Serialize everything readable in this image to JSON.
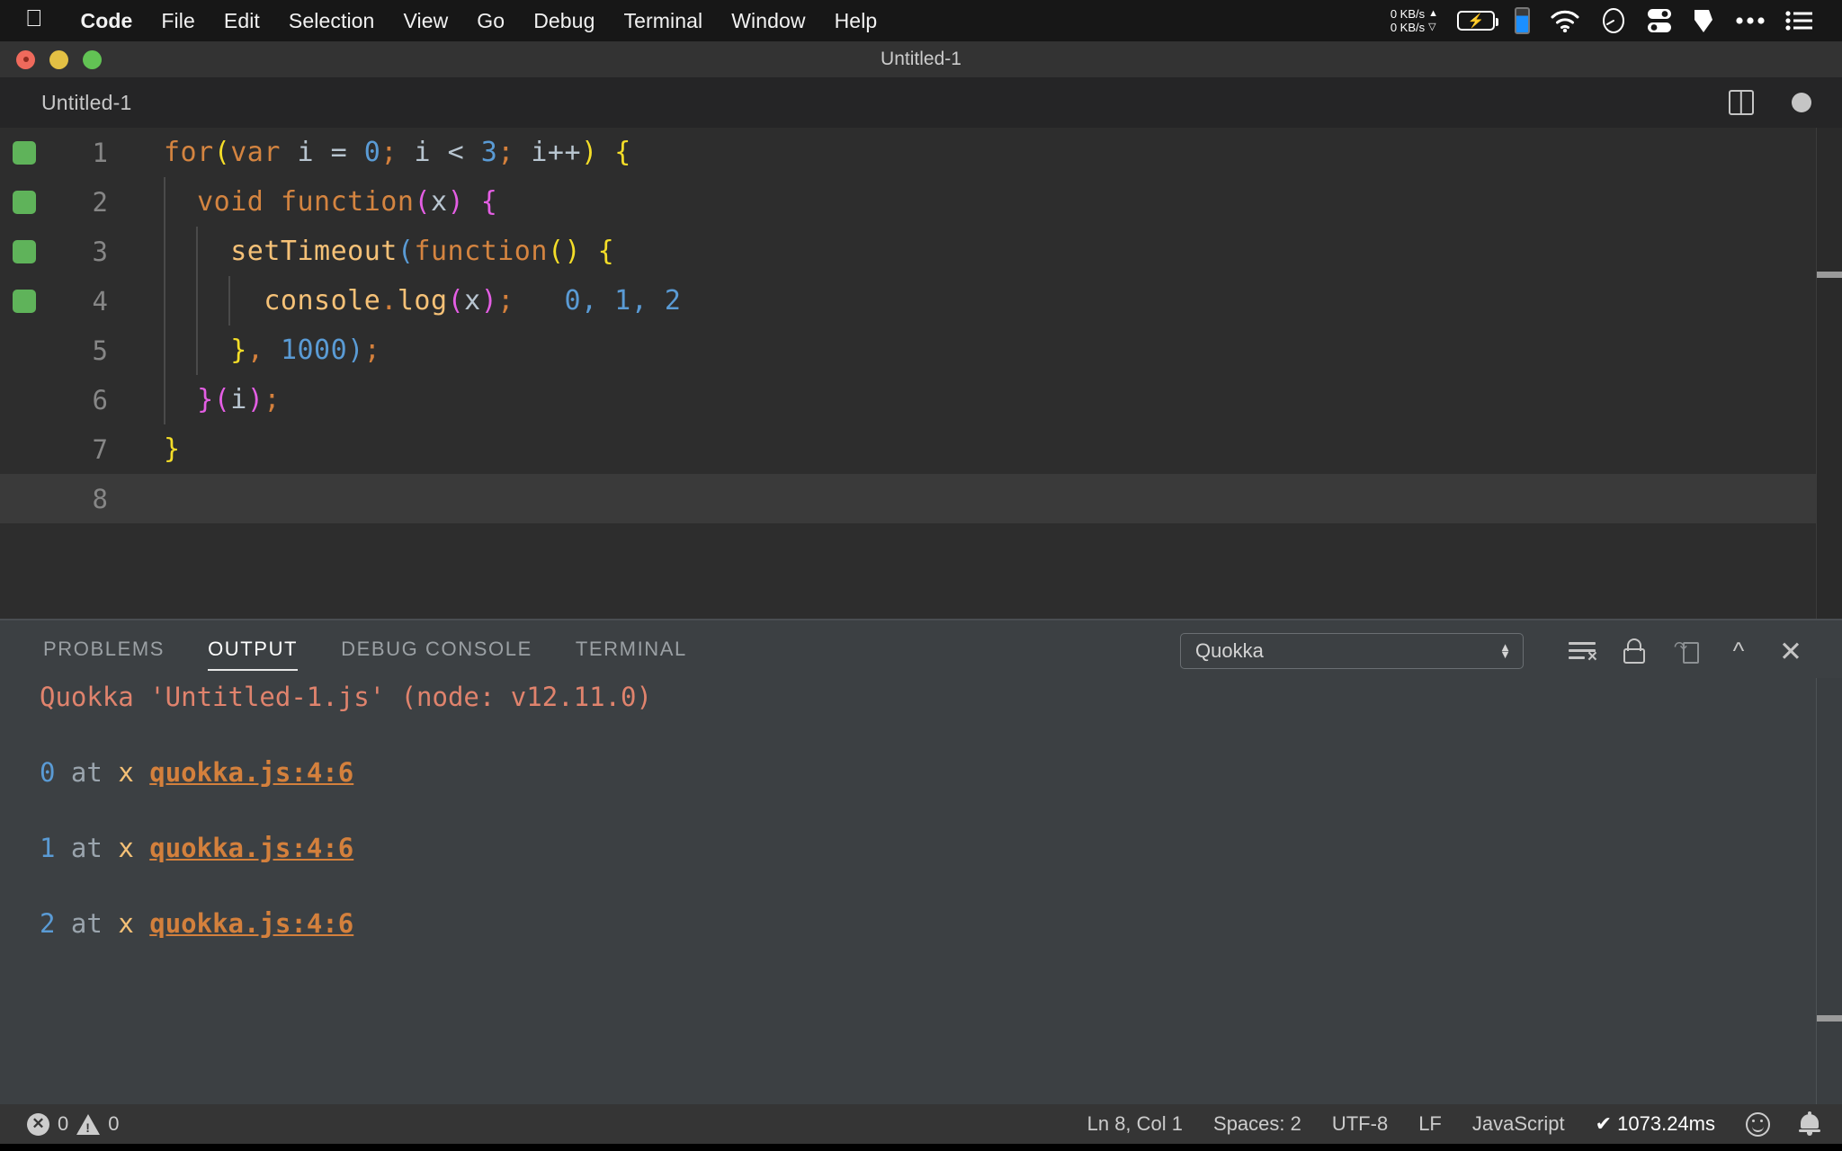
{
  "menubar": {
    "apple_icon": "apple-logo-icon",
    "items": [
      {
        "label": "Code",
        "bold": true
      },
      {
        "label": "File",
        "bold": false
      },
      {
        "label": "Edit",
        "bold": false
      },
      {
        "label": "Selection",
        "bold": false
      },
      {
        "label": "View",
        "bold": false
      },
      {
        "label": "Go",
        "bold": false
      },
      {
        "label": "Debug",
        "bold": false
      },
      {
        "label": "Terminal",
        "bold": false
      },
      {
        "label": "Window",
        "bold": false
      },
      {
        "label": "Help",
        "bold": false
      }
    ],
    "network": {
      "upload": "0 KB/s",
      "download": "0 KB/s",
      "up_arrow": "▲",
      "down_arrow": "▽"
    },
    "status_icons": [
      "battery-charging-icon",
      "blue-level-indicator-icon",
      "wifi-icon",
      "gauge-icon",
      "toggles-icon",
      "shield-pen-icon",
      "ellipsis-icon",
      "list-menu-icon"
    ]
  },
  "window": {
    "title": "Untitled-1",
    "traffic_lights": [
      "close-button",
      "minimize-button",
      "zoom-button"
    ]
  },
  "editor_title": {
    "tab_label": "Untitled-1",
    "split_icon": "split-editor-icon",
    "dirty_icon": "unsaved-dot-icon"
  },
  "editor": {
    "lines": [
      {
        "n": "1",
        "coverage": true,
        "active": false,
        "indent": 0,
        "tokens": [
          {
            "t": "for",
            "c": "t-kw"
          },
          {
            "t": "(",
            "c": "t-paren-y"
          },
          {
            "t": "var",
            "c": "t-kw"
          },
          {
            "t": " i ",
            "c": "t-var"
          },
          {
            "t": "= ",
            "c": "t-plain"
          },
          {
            "t": "0",
            "c": "t-num"
          },
          {
            "t": "; ",
            "c": "t-punct"
          },
          {
            "t": "i ",
            "c": "t-var"
          },
          {
            "t": "< ",
            "c": "t-plain"
          },
          {
            "t": "3",
            "c": "t-num"
          },
          {
            "t": "; ",
            "c": "t-punct"
          },
          {
            "t": "i++",
            "c": "t-var"
          },
          {
            "t": ")",
            "c": "t-paren-y"
          },
          {
            "t": " ",
            "c": "t-plain"
          },
          {
            "t": "{",
            "c": "t-paren-y"
          }
        ]
      },
      {
        "n": "2",
        "coverage": true,
        "active": false,
        "indent": 1,
        "tokens": [
          {
            "t": "  ",
            "c": "t-plain"
          },
          {
            "t": "void",
            "c": "t-kw"
          },
          {
            "t": " ",
            "c": "t-plain"
          },
          {
            "t": "function",
            "c": "t-kw"
          },
          {
            "t": "(",
            "c": "t-paren-m"
          },
          {
            "t": "x",
            "c": "t-var"
          },
          {
            "t": ")",
            "c": "t-paren-m"
          },
          {
            "t": " ",
            "c": "t-plain"
          },
          {
            "t": "{",
            "c": "t-paren-m"
          }
        ]
      },
      {
        "n": "3",
        "coverage": true,
        "active": false,
        "indent": 2,
        "tokens": [
          {
            "t": "    ",
            "c": "t-plain"
          },
          {
            "t": "setTimeout",
            "c": "t-fn"
          },
          {
            "t": "(",
            "c": "t-paren-b"
          },
          {
            "t": "function",
            "c": "t-kw"
          },
          {
            "t": "()",
            "c": "t-paren-y"
          },
          {
            "t": " ",
            "c": "t-plain"
          },
          {
            "t": "{",
            "c": "t-paren-y"
          }
        ]
      },
      {
        "n": "4",
        "coverage": true,
        "active": false,
        "indent": 3,
        "tokens": [
          {
            "t": "      ",
            "c": "t-plain"
          },
          {
            "t": "console",
            "c": "t-fn"
          },
          {
            "t": ".",
            "c": "t-punct"
          },
          {
            "t": "log",
            "c": "t-fn"
          },
          {
            "t": "(",
            "c": "t-paren-m"
          },
          {
            "t": "x",
            "c": "t-var"
          },
          {
            "t": ")",
            "c": "t-paren-m"
          },
          {
            "t": ";",
            "c": "t-punct"
          },
          {
            "t": "   0, 1, 2",
            "c": "t-inline"
          }
        ]
      },
      {
        "n": "5",
        "coverage": false,
        "active": false,
        "indent": 2,
        "tokens": [
          {
            "t": "    ",
            "c": "t-plain"
          },
          {
            "t": "}",
            "c": "t-paren-y"
          },
          {
            "t": ", ",
            "c": "t-punct"
          },
          {
            "t": "1000",
            "c": "t-num"
          },
          {
            "t": ")",
            "c": "t-paren-b"
          },
          {
            "t": ";",
            "c": "t-punct"
          }
        ]
      },
      {
        "n": "6",
        "coverage": false,
        "active": false,
        "indent": 1,
        "tokens": [
          {
            "t": "  ",
            "c": "t-plain"
          },
          {
            "t": "}",
            "c": "t-paren-m"
          },
          {
            "t": "(",
            "c": "t-paren-m"
          },
          {
            "t": "i",
            "c": "t-var"
          },
          {
            "t": ")",
            "c": "t-paren-m"
          },
          {
            "t": ";",
            "c": "t-punct"
          }
        ]
      },
      {
        "n": "7",
        "coverage": false,
        "active": false,
        "indent": 0,
        "tokens": [
          {
            "t": "}",
            "c": "t-paren-y"
          }
        ]
      },
      {
        "n": "8",
        "coverage": false,
        "active": true,
        "indent": 0,
        "tokens": []
      }
    ],
    "inline_value_line4": "0, 1, 2"
  },
  "panel": {
    "tabs": [
      {
        "label": "PROBLEMS",
        "active": false
      },
      {
        "label": "OUTPUT",
        "active": true
      },
      {
        "label": "DEBUG CONSOLE",
        "active": false
      },
      {
        "label": "TERMINAL",
        "active": false
      }
    ],
    "channel_select": {
      "value": "Quokka",
      "dropdown_icon": "stepper-arrows-icon"
    },
    "actions": [
      {
        "name": "clear-output-icon",
        "label": "Clear Output"
      },
      {
        "name": "lock-scroll-icon",
        "label": "Turn Auto Scrolling Off"
      },
      {
        "name": "open-in-editor-icon",
        "label": "Open Output in Editor"
      },
      {
        "name": "maximize-panel-icon",
        "label": "Maximize Panel Size"
      },
      {
        "name": "close-panel-icon",
        "label": "Close Panel"
      }
    ],
    "output": [
      {
        "type": "header",
        "text": "Quokka 'Untitled-1.js' (node: v12.11.0)"
      },
      {
        "type": "blank"
      },
      {
        "type": "log",
        "value": "0",
        "at": " at ",
        "x": "x",
        "link": "quokka.js:4:6"
      },
      {
        "type": "blank"
      },
      {
        "type": "log",
        "value": "1",
        "at": " at ",
        "x": "x",
        "link": "quokka.js:4:6"
      },
      {
        "type": "blank"
      },
      {
        "type": "log",
        "value": "2",
        "at": " at ",
        "x": "x",
        "link": "quokka.js:4:6"
      }
    ]
  },
  "statusbar": {
    "errors": "0",
    "warnings": "0",
    "error_icon": "error-circle-icon",
    "warning_icon": "warning-triangle-icon",
    "cursor_position": "Ln 8, Col 1",
    "indentation": "Spaces: 2",
    "encoding": "UTF-8",
    "eol": "LF",
    "language": "JavaScript",
    "quokka_time": "✔ 1073.24ms",
    "feedback_icon": "smiley-icon",
    "bell_icon": "bell-icon"
  },
  "colors": {
    "editor_bg": "#2d2d2d",
    "panel_bg": "#3c4043",
    "titlebar_bg": "#333333",
    "statusbar_bg": "#353535",
    "coverage_green": "#5fb35a",
    "link_orange": "#d4803c",
    "header_salmon": "#e0836d",
    "number_blue": "#5a9bd5"
  }
}
